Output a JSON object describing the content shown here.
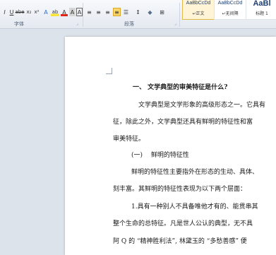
{
  "ribbon": {
    "font_group_label": "字体",
    "paragraph_group_label": "段落",
    "styles": [
      {
        "sample": "AaBbCcDd",
        "name": "↵正文"
      },
      {
        "sample": "AaBbCcDd",
        "name": "↵无间隔"
      },
      {
        "sample": "AaBl",
        "name": "标题 1"
      }
    ],
    "font_buttons": [
      "I",
      "U",
      "abe",
      "x₂",
      "x²",
      "A",
      "ab",
      "A",
      "A",
      "A"
    ],
    "paragraph_buttons": [
      "≡",
      "≡",
      "≡",
      "≡",
      "☰",
      "↕",
      "◆",
      "⊞"
    ]
  },
  "document": {
    "heading": "一、 文学典型的审美特征是什么?",
    "lines": [
      "文学典型是文学形象的高级形态之一。它具有",
      "征，除此之外，文学典型还具有鲜明的特征性和富",
      "审美特征。",
      "(一)　 鲜明的特征性",
      "鲜明的特征性主要指外在形态的生动、具体、",
      "刻丰富。其鲜明的特征性表现为以下两个层面：",
      "1.具有一种别人不具备唯他才有的、能贯串其",
      "整个生命的总特征。凡是世人公认的典型，无不具",
      "阿 Q 的 “精神胜利法”, 林黛玉的 “多愁善感” 便"
    ]
  }
}
